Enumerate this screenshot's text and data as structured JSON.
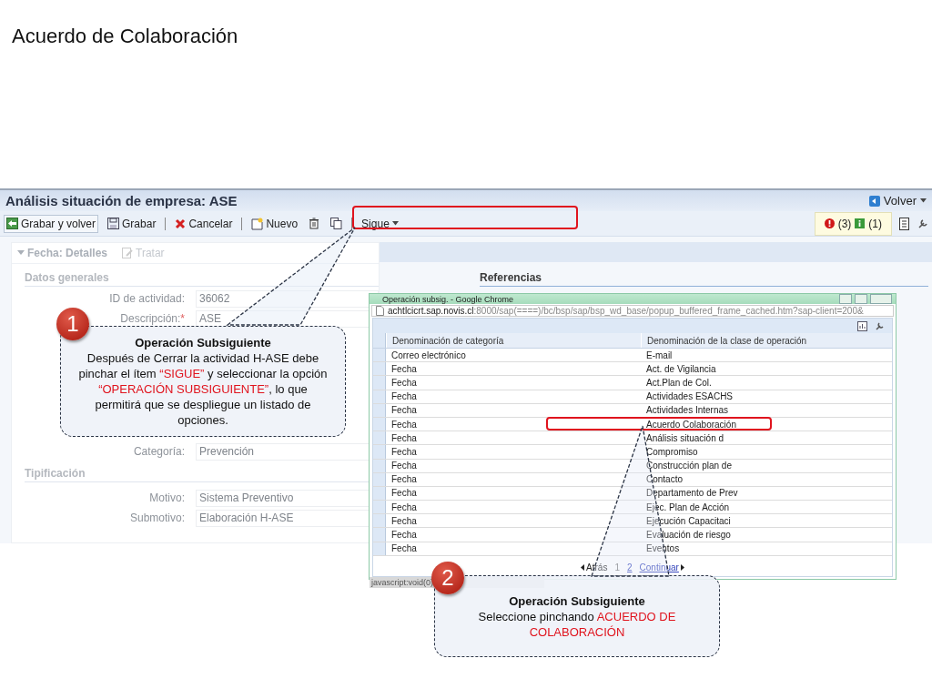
{
  "slide": {
    "title": "Acuerdo de Colaboración"
  },
  "app": {
    "title": "Análisis situación de empresa: ASE",
    "back_button": "Volver",
    "toolbar": [
      {
        "kind": "save-back",
        "label": "Grabar y volver",
        "highlighted": false
      },
      {
        "kind": "save",
        "label": "Grabar",
        "highlighted": false
      },
      {
        "kind": "cancel",
        "label": "Cancelar",
        "highlighted": false
      },
      {
        "kind": "new",
        "label": "Nuevo",
        "highlighted": false
      },
      {
        "kind": "delete",
        "highlighted": false
      },
      {
        "kind": "copy",
        "highlighted": false
      },
      {
        "kind": "menu",
        "label": "Sigue",
        "highlighted": true
      }
    ],
    "messages": {
      "errors": "(3)",
      "info": "(1)"
    },
    "section": {
      "title": "Fecha: Detalles",
      "edit": "Tratar"
    },
    "general": {
      "title": "Datos generales",
      "fields": [
        {
          "label": "ID de actividad:",
          "value": "36062"
        },
        {
          "label": "Descripción:",
          "required_mark": "*",
          "value": "ASE"
        }
      ],
      "fields_lower": [
        {
          "label": "Categoría:",
          "value": "Prevención"
        }
      ]
    },
    "typification": {
      "title": "Tipificación",
      "fields": [
        {
          "label": "Motivo:",
          "value": "Sistema Preventivo"
        },
        {
          "label": "Submotivo:",
          "value": "Elaboración H-ASE"
        }
      ]
    },
    "references": {
      "title": "Referencias"
    }
  },
  "popup": {
    "title": "Operación subsig. - Google Chrome",
    "url_host": "achtlcicrt.sap.novis.cl",
    "url_path": ":8000/sap(====)/bc/bsp/sap/bsp_wd_base/popup_buffered_frame_cached.htm?sap-client=200&",
    "columns": [
      "Denominación de categoría",
      "Denominación de la clase de operación"
    ],
    "rows": [
      {
        "category": "Correo electrónico",
        "type": "E-mail",
        "highlighted": false
      },
      {
        "category": "Fecha",
        "type": "Act. de Vigilancia",
        "highlighted": false
      },
      {
        "category": "Fecha",
        "type": "Act.Plan de Col.",
        "highlighted": false
      },
      {
        "category": "Fecha",
        "type": "Actividades ESACHS",
        "highlighted": false
      },
      {
        "category": "Fecha",
        "type": "Actividades Internas",
        "highlighted": false
      },
      {
        "category": "Fecha",
        "type": "Acuerdo Colaboración",
        "highlighted": true
      },
      {
        "category": "Fecha",
        "type": "Análisis situación d",
        "highlighted": false
      },
      {
        "category": "Fecha",
        "type": "Compromiso",
        "highlighted": false
      },
      {
        "category": "Fecha",
        "type": "Construcción plan de",
        "highlighted": false
      },
      {
        "category": "Fecha",
        "type": "Contacto",
        "highlighted": false
      },
      {
        "category": "Fecha",
        "type": "Departamento de Prev",
        "highlighted": false
      },
      {
        "category": "Fecha",
        "type": "Ejec. Plan de Acción",
        "highlighted": false
      },
      {
        "category": "Fecha",
        "type": "Ejecución Capacitaci",
        "highlighted": false
      },
      {
        "category": "Fecha",
        "type": "Evaluación de riesgo",
        "highlighted": false
      },
      {
        "category": "Fecha",
        "type": "Eventos",
        "highlighted": false
      }
    ],
    "pager": {
      "back": "Atrás",
      "pages": [
        {
          "label": "1",
          "selected": true
        },
        {
          "label": "2",
          "selected": false
        }
      ],
      "next": "Continuar"
    },
    "status": "javascript:void(0)"
  },
  "callouts": [
    {
      "number": "1",
      "title": "Operación Subsiguiente",
      "body": [
        {
          "text": "Después de Cerrar la actividad H-ASE debe pinchar el ítem ",
          "accent": false
        },
        {
          "text": "“SIGUE”",
          "accent": true
        },
        {
          "text": " y seleccionar la opción ",
          "accent": false
        },
        {
          "text": "“OPERACIÓN SUBSIGUIENTE”",
          "accent": true
        },
        {
          "text": ", lo que permitirá que se despliegue un listado de opciones.",
          "accent": false
        }
      ]
    },
    {
      "number": "2",
      "title": "Operación Subsiguiente",
      "body": [
        {
          "text": "Seleccione pinchando ",
          "accent": false
        },
        {
          "text": "ACUERDO DE COLABORACIÓN",
          "accent": true
        }
      ]
    }
  ]
}
